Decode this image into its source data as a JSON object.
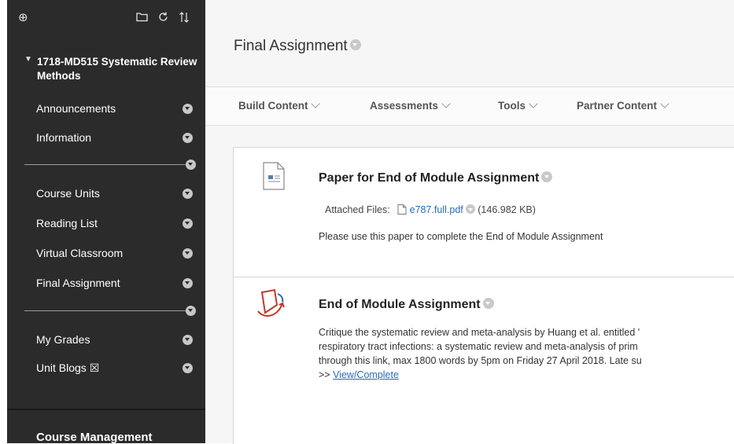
{
  "sidebar": {
    "toolbar_icons": [
      "plus-circle-icon",
      "folder-icon",
      "refresh-icon",
      "sort-icon"
    ],
    "course_title": "1718-MD515 Systematic Review Methods",
    "items_group1": [
      {
        "label": "Announcements"
      },
      {
        "label": "Information"
      }
    ],
    "items_group2": [
      {
        "label": "Course Units"
      },
      {
        "label": "Reading List"
      },
      {
        "label": "Virtual Classroom"
      },
      {
        "label": "Final Assignment"
      }
    ],
    "items_group3": [
      {
        "label": "My Grades"
      },
      {
        "label": "Unit Blogs ☒"
      }
    ],
    "course_management": "Course Management"
  },
  "main": {
    "page_title": "Final Assignment",
    "toolbar": [
      "Build Content",
      "Assessments",
      "Tools",
      "Partner Content"
    ],
    "items": [
      {
        "title": "Paper for End of Module Assignment",
        "attached_label": "Attached Files:",
        "file_name": "e787.full.pdf",
        "file_size": "(146.982 KB)",
        "description": "Please use this paper to complete the End of Module Assignment"
      },
      {
        "title": "End of Module Assignment",
        "lines": [
          "Critique the systematic review and meta-analysis by Huang et al. entitled '",
          "respiratory tract infections: a systematic review and meta-analysis of prim",
          "through this link, max 1800 words by 5pm on Friday 27 April 2018. Late su"
        ],
        "link_prefix": ">>",
        "link_label": "View/Complete"
      }
    ]
  },
  "colors": {
    "sidebar_bg": "#2b2b2b",
    "link": "#2a6bb3",
    "main_bg": "#f6f6f6"
  }
}
